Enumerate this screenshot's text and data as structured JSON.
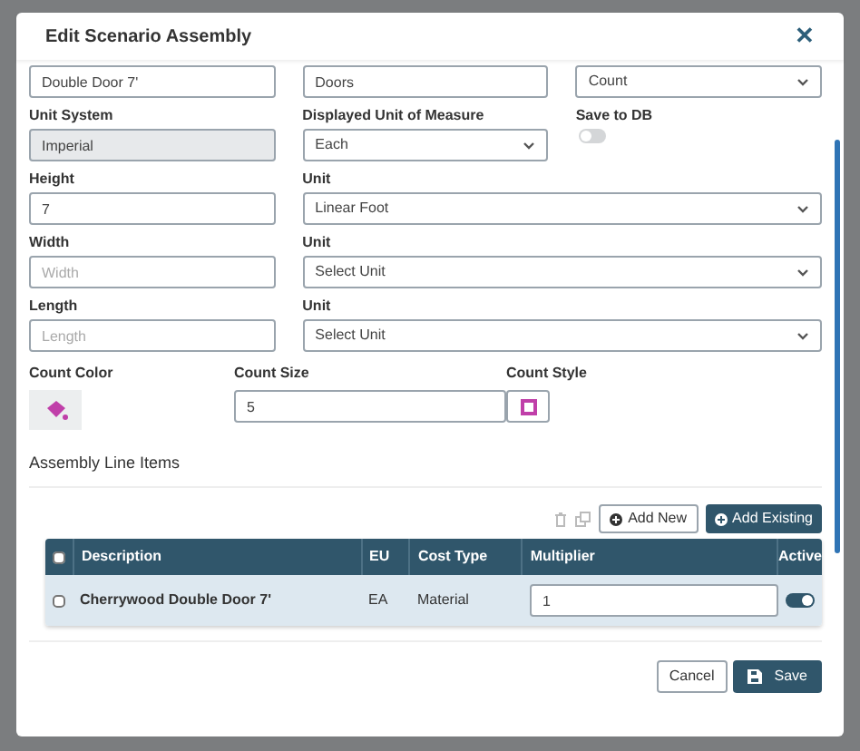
{
  "modal": {
    "title": "Edit Scenario Assembly",
    "close": "✕"
  },
  "top_fields": [
    {
      "kind": "input",
      "value": "Double Door 7'"
    },
    {
      "kind": "input",
      "value": "Doors"
    },
    {
      "kind": "select",
      "value": "Count"
    }
  ],
  "fields": [
    {
      "label": "Unit System",
      "kind": "input",
      "value": "Imperial",
      "disabled": true,
      "wide": false
    },
    {
      "label": "Displayed Unit of Measure",
      "kind": "select",
      "value": "Each",
      "wide": false
    },
    {
      "label": "Save to DB",
      "kind": "toggle",
      "on": false,
      "wide": false
    },
    {
      "label": "Height",
      "kind": "input",
      "value": "7",
      "disabled": false,
      "wide": false
    },
    {
      "label": "Unit",
      "kind": "select",
      "value": "Linear Foot",
      "wide": true
    },
    {
      "label": "Width",
      "kind": "input",
      "placeholder": "Width",
      "disabled": false,
      "wide": false
    },
    {
      "label": "Unit",
      "kind": "select",
      "value": "Select Unit",
      "wide": true
    },
    {
      "label": "Length",
      "kind": "input",
      "placeholder": "Length",
      "disabled": false,
      "wide": false
    },
    {
      "label": "Unit",
      "kind": "select",
      "value": "Select Unit",
      "wide": true
    }
  ],
  "count": {
    "color_label": "Count Color",
    "color": "#c03fa9",
    "size_label": "Count Size",
    "size": "5",
    "style_label": "Count Style"
  },
  "line_items": {
    "title": "Assembly Line Items",
    "add_new": "Add New",
    "add_existing": "Add Existing",
    "columns": [
      "Description",
      "EU",
      "Cost Type",
      "Multiplier",
      "Active"
    ],
    "all_checked": false,
    "rows": [
      {
        "checked": false,
        "description": "Cherrywood Double Door 7'",
        "eu": "EA",
        "cost_type": "Material",
        "multiplier": "1",
        "active": true
      }
    ]
  },
  "footer": {
    "cancel": "Cancel",
    "save": "Save"
  }
}
